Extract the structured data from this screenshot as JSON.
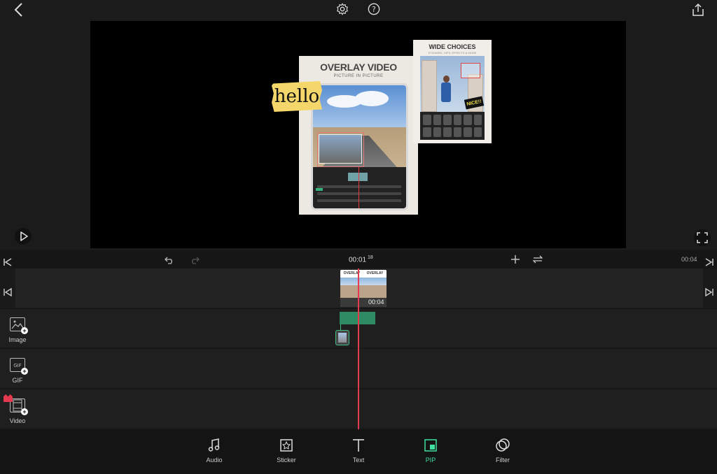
{
  "topbar": {
    "back_icon": "chevron-left-icon",
    "settings_icon": "gear-icon",
    "help_icon": "question-icon",
    "export_icon": "upload-icon"
  },
  "preview": {
    "overlay_card": {
      "title": "OVERLAY VIDEO",
      "subtitle": "PICTURE IN PICTURE"
    },
    "wide_card": {
      "title": "WIDE CHOICES",
      "subtitle": "STICKERS, GIFS, EFFECTS & MORE",
      "badge": "NICE!!"
    },
    "sticker_text": "hello"
  },
  "timeline": {
    "current_time": "00:01",
    "current_frame": "18",
    "total_time": "00:04",
    "clip_duration": "00:04",
    "clip_caption_a": "OVERLAY",
    "clip_caption_b": "OVERLAY"
  },
  "tracks": [
    {
      "label": "Image",
      "icon": "image-add-icon"
    },
    {
      "label": "GIF",
      "icon": "gif-add-icon"
    },
    {
      "label": "Video",
      "icon": "video-add-icon"
    }
  ],
  "toolbar": [
    {
      "label": "Audio",
      "icon": "music-note-icon"
    },
    {
      "label": "Sticker",
      "icon": "sticker-icon"
    },
    {
      "label": "Text",
      "icon": "text-icon"
    },
    {
      "label": "PIP",
      "icon": "pip-icon",
      "active": true
    },
    {
      "label": "Filter",
      "icon": "filter-icon"
    }
  ],
  "colors": {
    "background": "#1b1b1b",
    "accent": "#3fe0a0",
    "playhead": "#e5394f",
    "pip_bar": "#2e8b63"
  }
}
